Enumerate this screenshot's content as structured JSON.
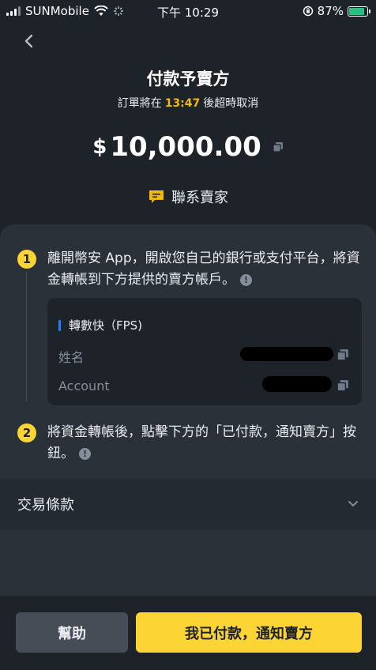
{
  "status_bar": {
    "carrier": "SUNMobile",
    "time": "下午 10:29",
    "battery": "87%"
  },
  "header": {
    "title": "付款予賣方",
    "timer_prefix": "訂單將在",
    "timer_value": "13:47",
    "timer_suffix": "後超時取消"
  },
  "amount": {
    "currency_symbol": "$",
    "value": "10,000.00"
  },
  "contact_seller_label": "聯系賣家",
  "steps": [
    {
      "number": "1",
      "text": "離開幣安 App，開啟您自己的銀行或支付平台，將資金轉帳到下方提供的賣方帳戶。"
    },
    {
      "number": "2",
      "text": "將資金轉帳後，點擊下方的「已付款，通知賣方」按鈕。"
    }
  ],
  "payment": {
    "method": "轉數快（FPS)",
    "name_label": "姓名",
    "account_label": "Account"
  },
  "terms_label": "交易條款",
  "buttons": {
    "help": "幫助",
    "paid": "我已付款，通知賣方"
  },
  "colors": {
    "background": "#1e2329",
    "card": "#2b3139",
    "accent_yellow": "#fcd535",
    "timer_yellow": "#f0b90b",
    "fps_blue": "#1e80ff"
  },
  "icons": {
    "back": "chevron-left-icon",
    "copy": "copy-icon",
    "contact": "chat-bubble-icon",
    "info": "exclamation-info-icon",
    "terms": "chevron-down-icon"
  }
}
